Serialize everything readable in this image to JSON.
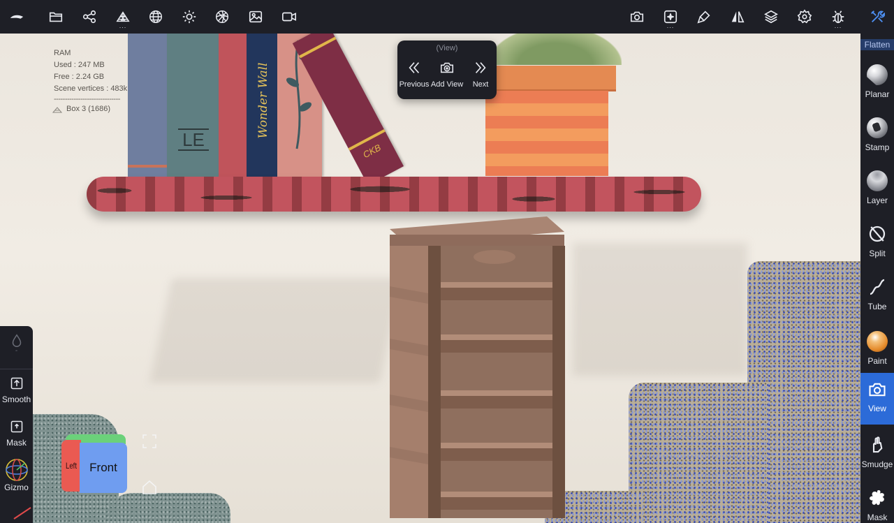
{
  "toolbar": {
    "left": [
      {
        "name": "app-menu-icon"
      },
      {
        "name": "folder-icon"
      },
      {
        "name": "share-nodes-icon"
      },
      {
        "name": "topology-icon",
        "dots": "..."
      },
      {
        "name": "sphere-grid-icon"
      },
      {
        "name": "sun-icon"
      },
      {
        "name": "material-ball-icon"
      },
      {
        "name": "image-icon"
      },
      {
        "name": "video-icon"
      }
    ],
    "right": [
      {
        "name": "camera-icon"
      },
      {
        "name": "sparkle-frame-icon",
        "dots": "..."
      },
      {
        "name": "brush-icon"
      },
      {
        "name": "symmetry-icon"
      },
      {
        "name": "layers-icon"
      },
      {
        "name": "settings-icon"
      },
      {
        "name": "bug-icon",
        "dots": "..."
      },
      {
        "name": "tools-icon"
      }
    ]
  },
  "stats": {
    "ram_label": "RAM",
    "used": "Used : 247 MB",
    "free": "Free : 2.24 GB",
    "vertices": "Scene vertices : 483k",
    "separator": "------------------------------",
    "object": "Box 3 (1686)"
  },
  "view_popup": {
    "title": "(View)",
    "previous_label": "Previous",
    "add_view_label": "Add View",
    "next_label": "Next"
  },
  "right_panel": {
    "flatten_label": "Flatten",
    "tools": [
      {
        "label": "Planar",
        "icon": "planar-sphere-icon"
      },
      {
        "label": "Stamp",
        "icon": "stamp-sphere-icon"
      },
      {
        "label": "Layer",
        "icon": "layer-sphere-icon"
      },
      {
        "label": "Split",
        "icon": "split-icon"
      },
      {
        "label": "Tube",
        "icon": "tube-icon"
      },
      {
        "label": "Paint",
        "icon": "paint-sphere-icon"
      },
      {
        "label": "View",
        "icon": "camera-icon",
        "active": true
      },
      {
        "label": "Smudge",
        "icon": "smudge-icon"
      },
      {
        "label": "Mask",
        "icon": "mask-splat-icon"
      }
    ]
  },
  "left_panel": {
    "top_value": "-",
    "smooth_label": "Smooth",
    "mask_label": "Mask",
    "gizmo_label": "Gizmo"
  },
  "cube": {
    "front": "Front",
    "left": "Left"
  },
  "scene_text": {
    "book1": "LE",
    "book2": "Wonder Wall",
    "book3": "CKB"
  },
  "colors": {
    "toolbar_bg": "#1e1f26",
    "accent_active": "#2c6bd8",
    "accent_tools_icon": "#4d8ef0"
  }
}
